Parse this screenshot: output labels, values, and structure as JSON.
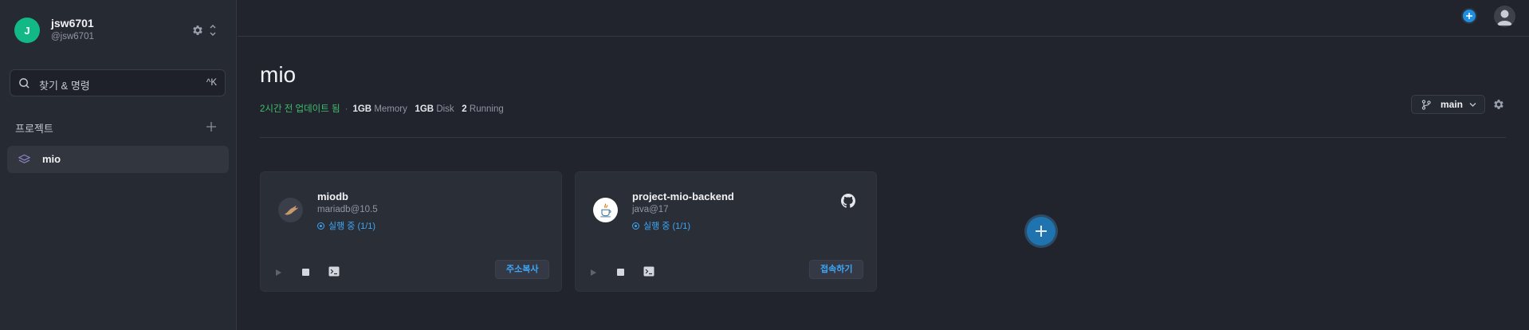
{
  "sidebar": {
    "user": {
      "initial": "J",
      "name": "jsw6701",
      "handle": "@jsw6701",
      "icons": [
        "gear-icon",
        "chevron-up-down-icon"
      ]
    },
    "search": {
      "placeholder": "찾기 & 명령",
      "shortcut": "^K",
      "icon": "search-icon"
    },
    "projects": {
      "header": "프로젝트",
      "add_icon": "plus-icon",
      "items": [
        {
          "label": "mio",
          "icon": "layers-icon",
          "selected": true
        }
      ]
    }
  },
  "topbar": {
    "icons": [
      "plus-circle-icon",
      "user-avatar-icon"
    ],
    "accent": "#1c8fe0"
  },
  "main": {
    "title": "mio",
    "meta": {
      "updated": "2시간 전 업데이트 됨",
      "memory_value": "1GB",
      "memory_label": "Memory",
      "disk_value": "1GB",
      "disk_label": "Disk",
      "running_value": "2",
      "running_label": "Running"
    },
    "branch": {
      "label": "main",
      "icon": "git-branch-icon"
    },
    "settings_icon": "gear-icon",
    "services": [
      {
        "name": "miodb",
        "version": "mariadb@10.5",
        "status": "실행 중 (1/1)",
        "action": "주소복사",
        "logo": "mariadb-seal-icon",
        "controls": [
          "play-icon",
          "stop-icon",
          "terminal-icon"
        ]
      },
      {
        "name": "project-mio-backend",
        "version": "java@17",
        "status": "실행 중 (1/1)",
        "action": "접속하기",
        "logo": "java-cup-icon",
        "repo_icon": "github-icon",
        "controls": [
          "play-icon",
          "stop-icon",
          "terminal-icon"
        ]
      }
    ],
    "add_service_icon": "plus-circle-icon"
  },
  "colors": {
    "background": "#21242d",
    "sidebar": "#262a33",
    "status_running": "#3ea6f5",
    "updated_green": "#3fbf6b",
    "avatar_green": "#12b886"
  }
}
